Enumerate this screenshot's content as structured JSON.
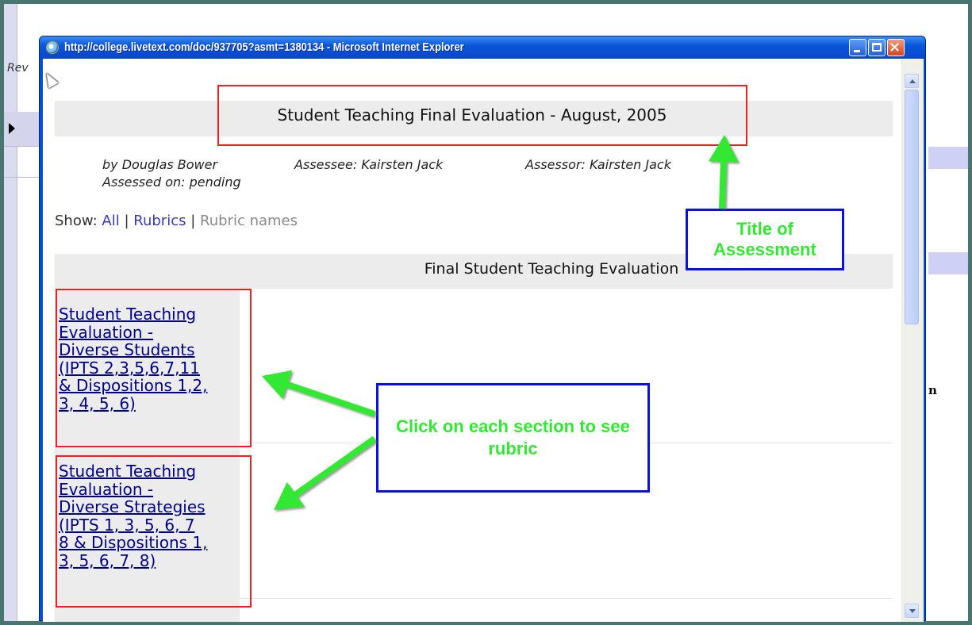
{
  "background": {
    "partial_text": "Rev",
    "partial_char": "n"
  },
  "window": {
    "title": "http://college.livetext.com/doc/937705?asmt=1380134 - Microsoft Internet Explorer",
    "buttons": {
      "minimize": "minimize",
      "maximize": "maximize",
      "close": "×"
    }
  },
  "document": {
    "title": "Student Teaching Final Evaluation - August, 2005",
    "by": "by Douglas Bower",
    "assessee": "Assessee: Kairsten Jack",
    "assessor": "Assessor: Kairsten Jack",
    "assessed_on": "Assessed on: pending",
    "show": {
      "label": "Show:",
      "all": "All",
      "rubrics": "Rubrics",
      "rubric_names": "Rubric names",
      "separator": "|"
    },
    "section_heading": "Final Student Teaching Evaluation",
    "rubrics": [
      {
        "lines": [
          "Student Teaching",
          "Evaluation -",
          "Diverse Students",
          "(IPTS 2,3,5,6,7,11",
          "& Dispositions 1,2,",
          "3, 4, 5, 6)"
        ]
      },
      {
        "lines": [
          "Student Teaching",
          "Evaluation -",
          "Diverse Strategies",
          "(IPTS 1, 3, 5, 6, 7",
          "8 & Dispositions 1,",
          "3, 5, 6, 7, 8)"
        ]
      }
    ]
  },
  "annotations": {
    "title_callout": [
      "Title of",
      "Assessment"
    ],
    "click_callout": "Click on each section to see rubric",
    "box_color": "#ee2020",
    "callout_border": "#0a10e0",
    "callout_text_color": "#33e833",
    "arrow_color": "#33e833"
  }
}
